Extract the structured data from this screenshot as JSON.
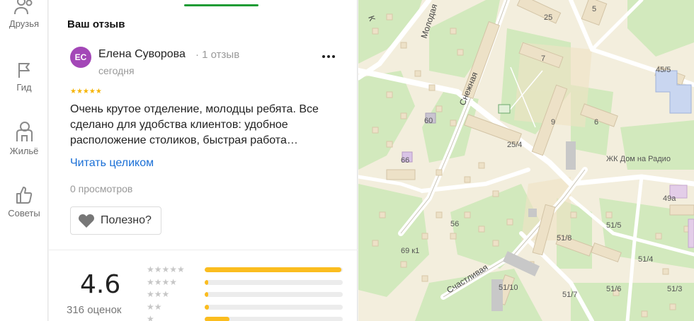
{
  "nav": {
    "items": [
      {
        "label": "Друзья",
        "icon": "people-icon"
      },
      {
        "label": "Гид",
        "icon": "flag-icon"
      },
      {
        "label": "Жильё",
        "icon": "house-person-icon"
      },
      {
        "label": "Советы",
        "icon": "thumb-up-icon"
      }
    ]
  },
  "review": {
    "section_title": "Ваш отзыв",
    "author": {
      "initials": "ЕС",
      "name": "Елена Суворова",
      "meta": "· 1 отзыв",
      "date": "сегодня",
      "avatar_color": "#a347b7"
    },
    "rating": 5,
    "text": "Очень крутое отделение, молодцы ребята. Все сделано для удобства клиентов: удобное расположение столиков, быстрая работа…",
    "read_more": "Читать целиком",
    "views": "0 просмотров",
    "useful_label": "Полезно?"
  },
  "summary": {
    "rating": "4.6",
    "count": "316 оценок",
    "distribution": [
      {
        "stars": 5,
        "fraction": 0.99
      },
      {
        "stars": 4,
        "fraction": 0.01
      },
      {
        "stars": 3,
        "fraction": 0.01
      },
      {
        "stars": 2,
        "fraction": 0.03
      },
      {
        "stars": 1,
        "fraction": 0.18
      }
    ]
  },
  "map": {
    "streets": [
      "Молодая",
      "Снежная",
      "Счастливая"
    ],
    "labels": [
      "25",
      "5",
      "7",
      "45/5",
      "9",
      "6",
      "60",
      "25/4",
      "66",
      "ЖК Дом на Радио",
      "49а",
      "56",
      "51/5",
      "51/8",
      "69 к1",
      "51/4",
      "51/10",
      "51/6",
      "51/3",
      "51/7"
    ],
    "colors": {
      "road": "#ffffff",
      "green": "#cfe8b8",
      "building": "#ecdcc0",
      "accent": "#1c9b34"
    }
  }
}
